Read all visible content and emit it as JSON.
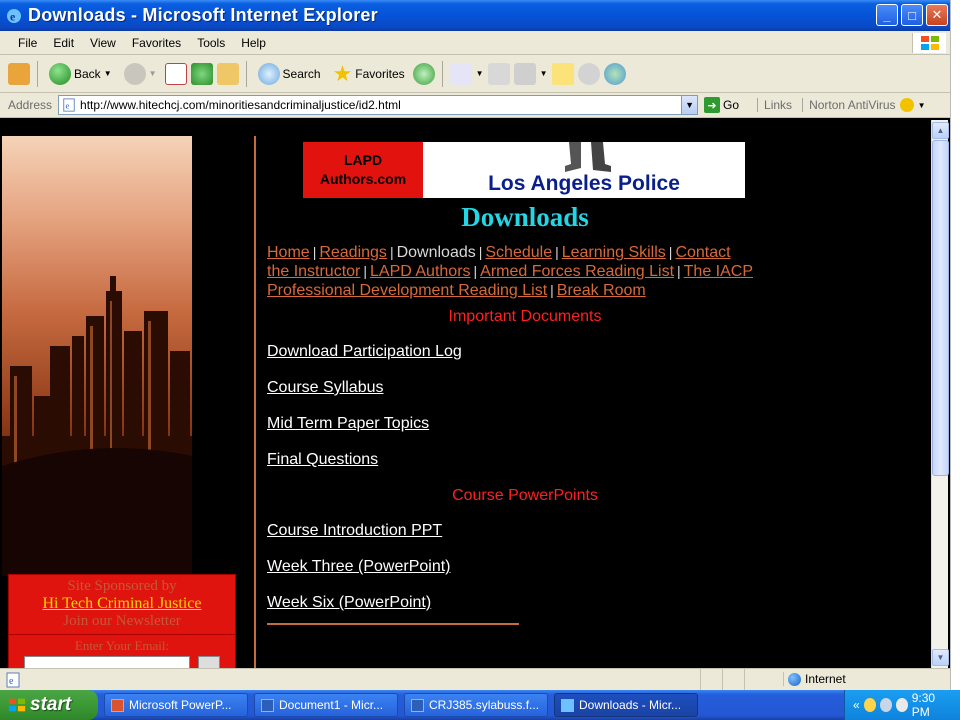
{
  "window": {
    "title": "Downloads - Microsoft Internet Explorer",
    "buttons": {
      "minimize": "_",
      "maximize": "□",
      "close": "✕"
    }
  },
  "menu": {
    "items": [
      "File",
      "Edit",
      "View",
      "Favorites",
      "Tools",
      "Help"
    ]
  },
  "toolbar": {
    "back": "Back",
    "search": "Search",
    "favorites": "Favorites"
  },
  "address": {
    "label": "Address",
    "url": "http://www.hitechcj.com/minoritiesandcriminaljustice/id2.html",
    "go": "Go",
    "links": "Links",
    "norton": "Norton AntiVirus"
  },
  "page": {
    "banner": {
      "lapd_line1": "LAPD",
      "lapd_line2": "Authors.com",
      "la_police": "Los Angeles Police"
    },
    "title": "Downloads",
    "nav": {
      "home": "Home",
      "readings": "Readings",
      "downloads": "Downloads",
      "schedule": "Schedule",
      "learning_skills": "Learning Skills",
      "contact_1": "Contact",
      "contact_2": "the Instructor",
      "lapd_authors": "LAPD Authors",
      "armed_forces": "Armed Forces Reading List",
      "iacp_1": "The IACP",
      "iacp_2": "Professional Development Reading List",
      "break_room": "Break Room"
    },
    "sections": {
      "important": "Important Documents",
      "powerpoints": "Course PowerPoints"
    },
    "documents": [
      "Download Participation Log",
      "Course Syllabus",
      "Mid Term Paper Topics",
      "Final Questions"
    ],
    "powerpoints": [
      "Course Introduction PPT",
      "Week Three (PowerPoint)",
      "Week Six (PowerPoint)"
    ],
    "sponsor": {
      "line1": "Site Sponsored by",
      "link": "Hi Tech Criminal Justice",
      "line3": "Join our Newsletter",
      "email_label": "Enter Your Email:"
    }
  },
  "status": {
    "zone": "Internet"
  },
  "taskbar": {
    "start": "start",
    "tasks": [
      "Microsoft PowerP...",
      "Document1 - Micr...",
      "CRJ385.sylabuss.f...",
      "Downloads - Micr..."
    ],
    "time": "9:30 PM"
  }
}
